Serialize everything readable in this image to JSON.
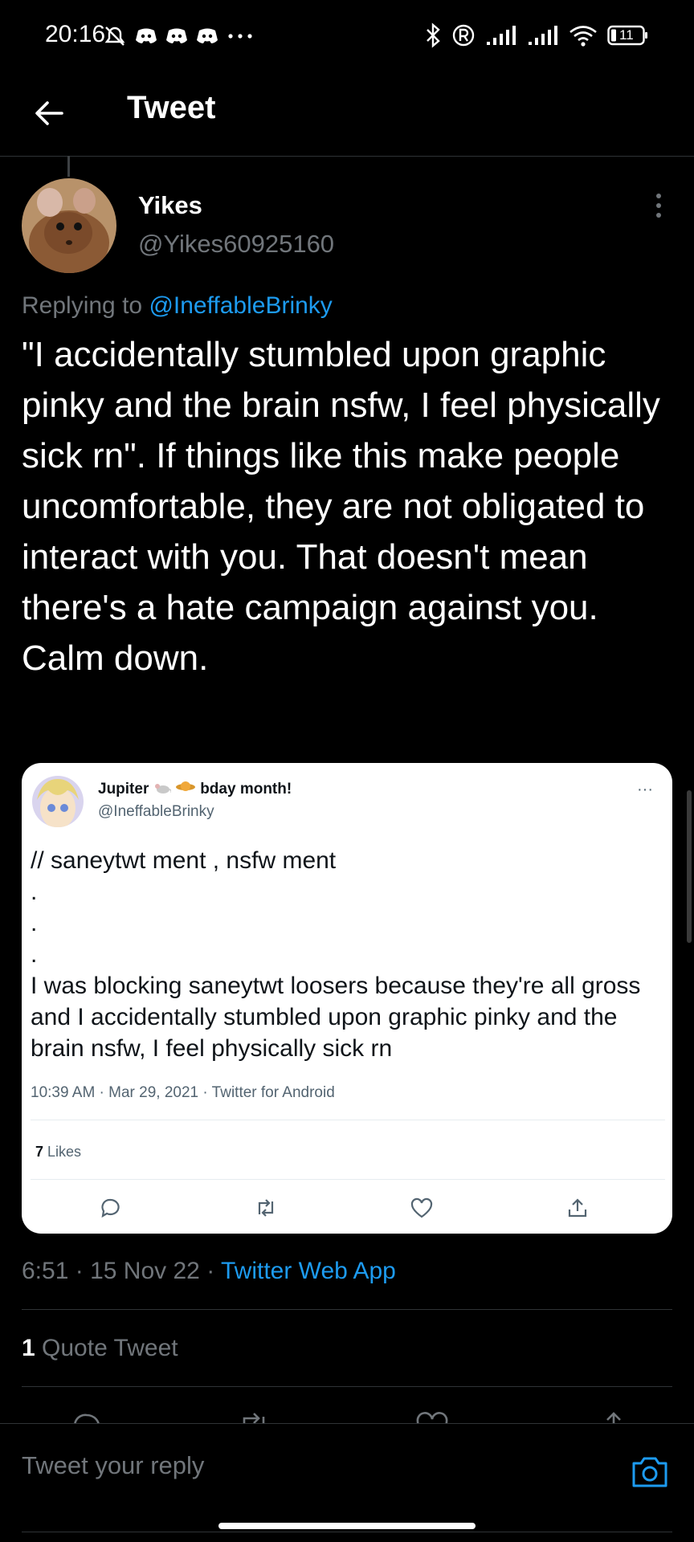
{
  "status_bar": {
    "time": "20:16",
    "battery": "11",
    "icons_left": [
      "alarm-off-icon",
      "discord-icon",
      "discord-icon",
      "discord-icon",
      "more-dots-icon"
    ],
    "icons_right": [
      "bluetooth-icon",
      "registered-icon",
      "signal-icon",
      "signal-icon",
      "wifi-icon",
      "battery-icon"
    ]
  },
  "header": {
    "title": "Tweet"
  },
  "tweet": {
    "author_name": "Yikes",
    "author_handle": "@Yikes60925160",
    "replying_prefix": "Replying to",
    "replying_to": "@IneffableBrinky",
    "text": "\"I accidentally stumbled upon graphic pinky and the brain nsfw, I feel physically sick rn\". If things like this make people uncomfortable, they are not obligated to interact with you. That doesn't mean there's a hate campaign against you. Calm down.",
    "time": "6:51",
    "date": "15 Nov 22",
    "separator": "·",
    "app": "Twitter Web App",
    "quote_count": "1",
    "quote_label": "Quote Tweet"
  },
  "quoted": {
    "name_prefix": "Jupiter",
    "name_suffix": "bday month!",
    "handle": "@IneffableBrinky",
    "more": "···",
    "text": "// saneytwt ment , nsfw ment\n.\n.\n.\nI was blocking saneytwt loosers because they're all gross and I accidentally stumbled upon graphic pinky and the brain nsfw, I feel physically sick rn",
    "meta": "10:39 AM · Mar 29, 2021 · Twitter for Android",
    "likes_count": "7",
    "likes_label": "Likes"
  },
  "reply_bar": {
    "placeholder": "Tweet your reply"
  },
  "colors": {
    "accent": "#1d9bf0",
    "background": "#000000",
    "muted": "#71767b"
  }
}
